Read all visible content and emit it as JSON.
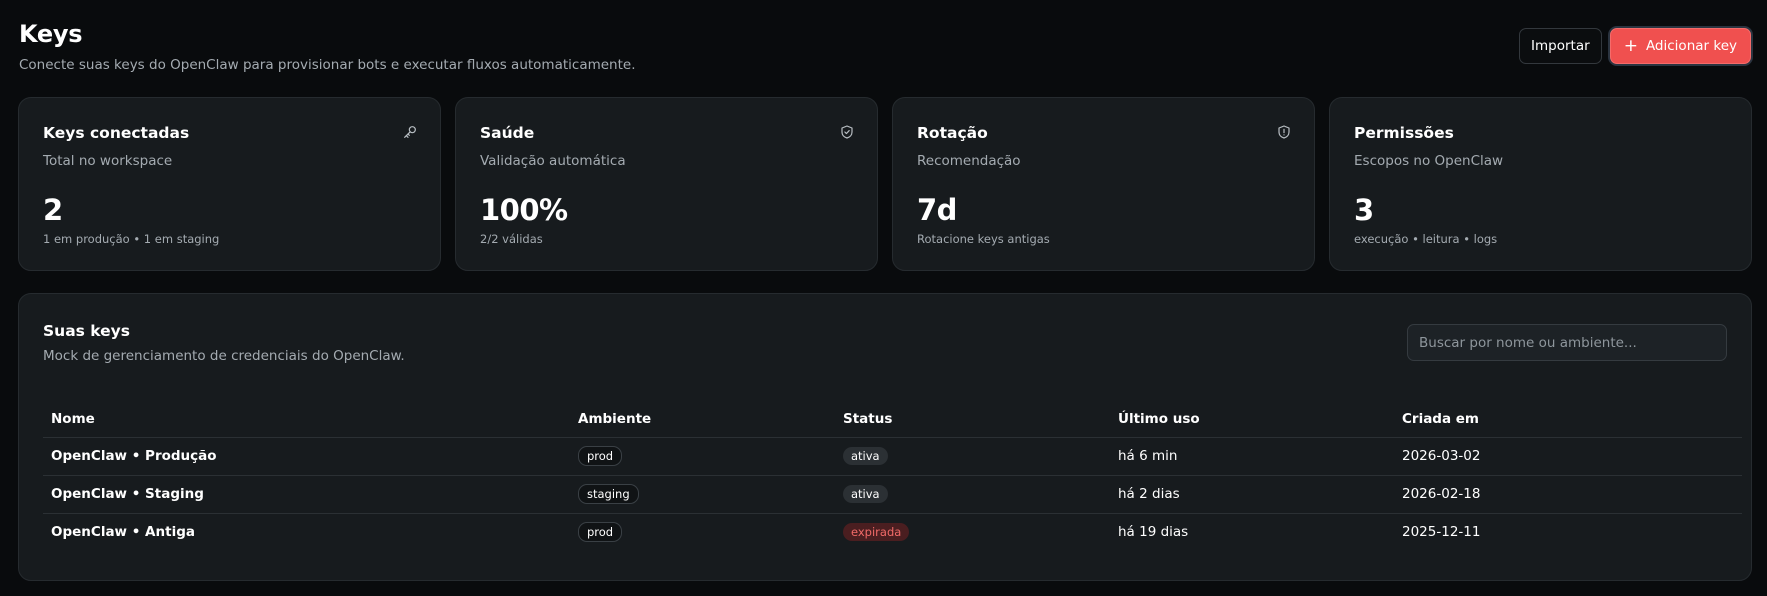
{
  "header": {
    "title": "Keys",
    "subtitle": "Conecte suas keys do OpenClaw para provisionar bots e executar fluxos automaticamente."
  },
  "actions": {
    "import_label": "Importar",
    "add_label": "Adicionar key"
  },
  "stats": [
    {
      "title": "Keys conectadas",
      "desc": "Total no workspace",
      "value": "2",
      "note": "1 em produção • 1 em staging",
      "icon": "key-icon"
    },
    {
      "title": "Saúde",
      "desc": "Validação automática",
      "value": "100%",
      "note": "2/2 válidas",
      "icon": "shield-check-icon"
    },
    {
      "title": "Rotação",
      "desc": "Recomendação",
      "value": "7d",
      "note": "Rotacione keys antigas",
      "icon": "shield-alert-icon"
    },
    {
      "title": "Permissões",
      "desc": "Escopos no OpenClaw",
      "value": "3",
      "note": "execução • leitura • logs"
    }
  ],
  "keys_panel": {
    "title": "Suas keys",
    "desc": "Mock de gerenciamento de credenciais do OpenClaw.",
    "search_placeholder": "Buscar por nome ou ambiente...",
    "columns": [
      "Nome",
      "Ambiente",
      "Status",
      "Último uso",
      "Criada em"
    ],
    "rows": [
      {
        "name": "OpenClaw • Produção",
        "env": "prod",
        "status": "ativa",
        "last_used": "há 6 min",
        "created": "2026-03-02"
      },
      {
        "name": "OpenClaw • Staging",
        "env": "staging",
        "status": "ativa",
        "last_used": "há 2 dias",
        "created": "2026-02-18"
      },
      {
        "name": "OpenClaw • Antiga",
        "env": "prod",
        "status": "expirada",
        "last_used": "há 19 dias",
        "created": "2025-12-11"
      }
    ]
  },
  "colors": {
    "accent": "#f0504f",
    "background": "#090b0d",
    "card": "#171b1e",
    "expired": "#f06a68"
  }
}
